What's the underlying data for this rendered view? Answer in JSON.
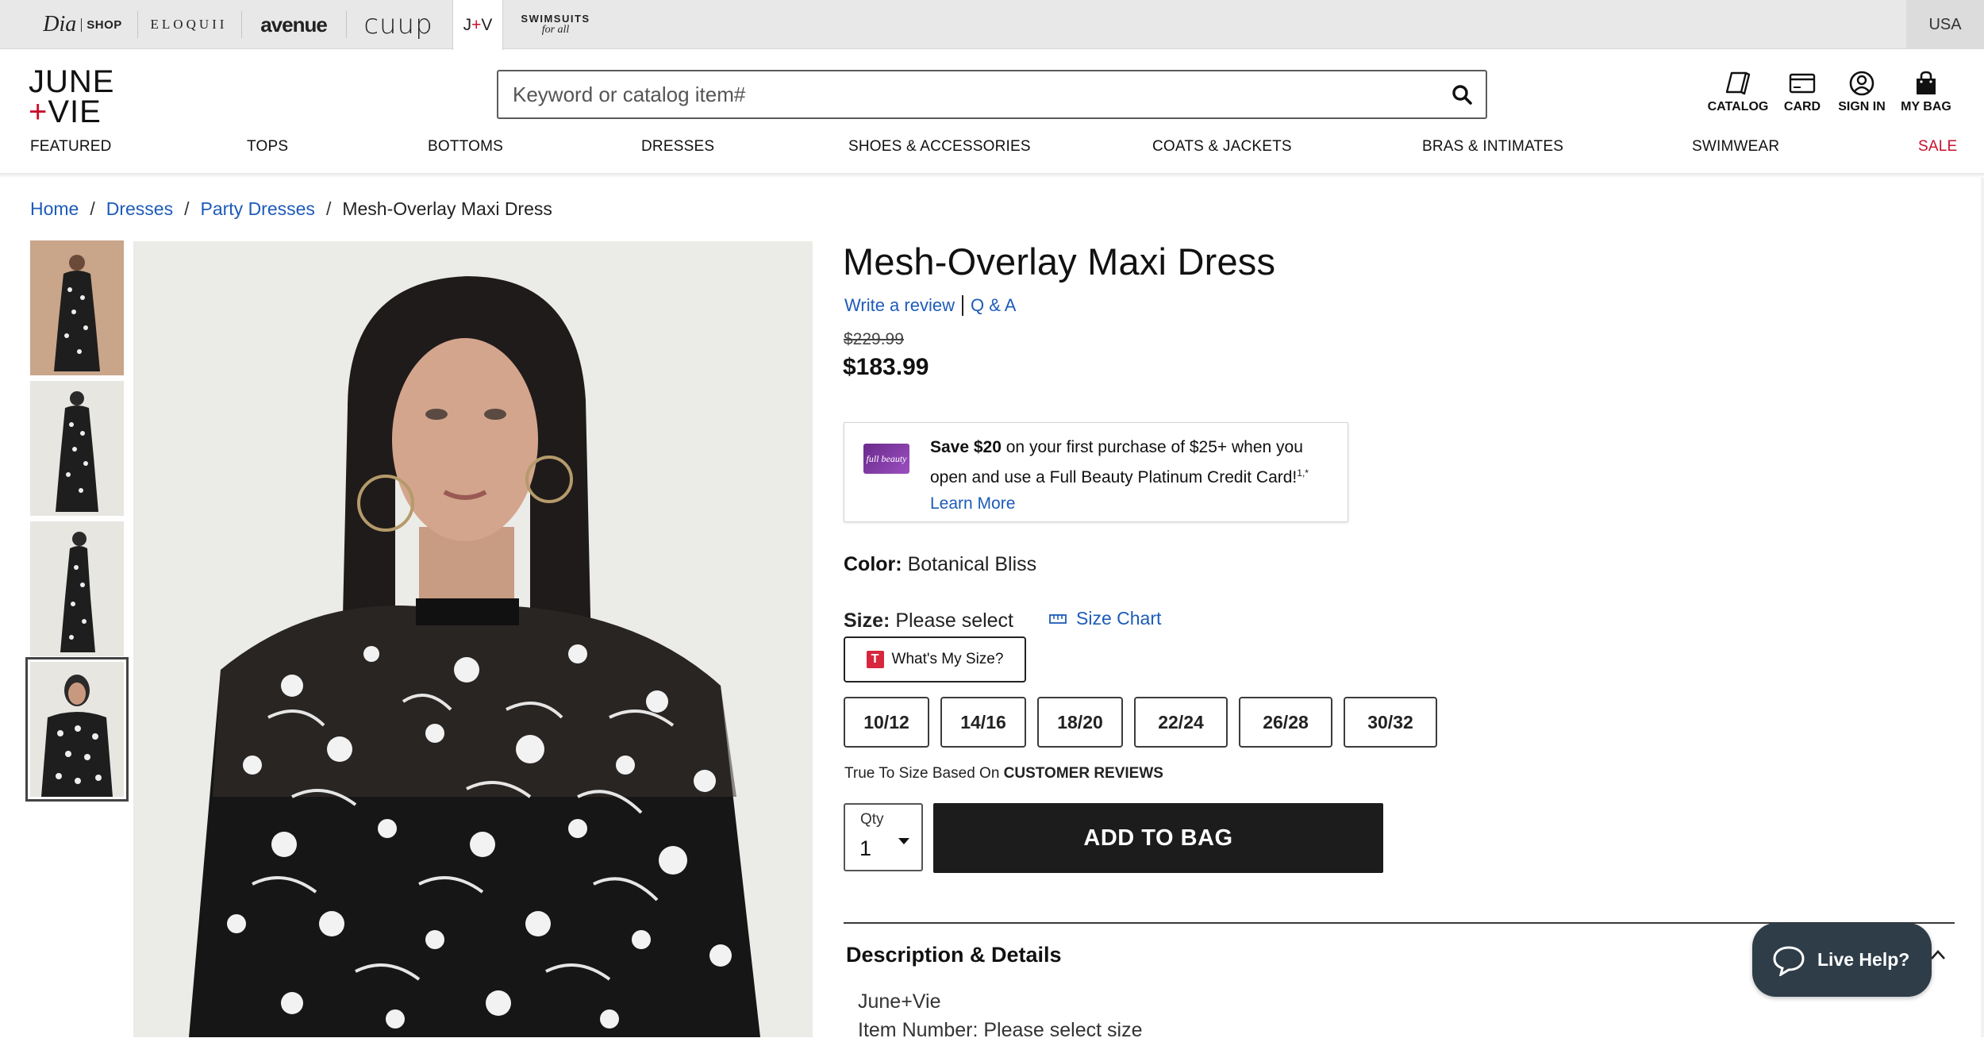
{
  "brands": {
    "dia": "Dia",
    "dia_shop": "SHOP",
    "eloquii": "ELOQUII",
    "avenue": "avenue",
    "cuup": "CUUP",
    "jv_left": "J",
    "jv_plus": "+",
    "jv_right": "V",
    "swim_top": "SWIMSUITS",
    "swim_bottom": "for all",
    "country": "USA"
  },
  "header": {
    "logo_line1": "JUNE",
    "logo_plus": "+",
    "logo_line2": "VIE",
    "search_placeholder": "Keyword or catalog item#",
    "icons": {
      "catalog": "CATALOG",
      "card": "CARD",
      "signin": "SIGN IN",
      "bag": "MY BAG"
    }
  },
  "nav": [
    "FEATURED",
    "TOPS",
    "BOTTOMS",
    "DRESSES",
    "SHOES & ACCESSORIES",
    "COATS & JACKETS",
    "BRAS & INTIMATES",
    "SWIMWEAR",
    "SALE"
  ],
  "breadcrumb": [
    "Home",
    "Dresses",
    "Party Dresses",
    "Mesh-Overlay Maxi Dress"
  ],
  "product": {
    "title": "Mesh-Overlay Maxi Dress",
    "write_review": "Write a review",
    "qa": "Q & A",
    "original_price": "$229.99",
    "price": "$183.99",
    "promo_bold": "Save $20",
    "promo_text": " on your first purchase of $25+ when you open and use a Full Beauty Platinum Credit Card!",
    "promo_sup": "1,*",
    "promo_link": "Learn More",
    "card_logo": "full beauty",
    "color_label": "Color:",
    "color_value": "Botanical Bliss",
    "size_label": "Size:",
    "size_value": "Please select",
    "size_chart": "Size Chart",
    "whats_my_size": "What's My Size?",
    "sizes": [
      "10/12",
      "14/16",
      "18/20",
      "22/24",
      "26/28",
      "30/32"
    ],
    "tts_text": "True To Size Based On ",
    "tts_bold": "CUSTOMER REVIEWS",
    "qty_label": "Qty",
    "qty_value": "1",
    "add_to_bag": "ADD TO BAG",
    "desc_heading": "Description & Details",
    "desc_brand": "June+Vie",
    "desc_item": "Item Number: Please select size"
  },
  "live_help": "Live Help?",
  "colors": {
    "link": "#1d5bb8",
    "sale": "#c8102e",
    "button": "#1c1c1c",
    "live_help": "#2e3d48"
  }
}
